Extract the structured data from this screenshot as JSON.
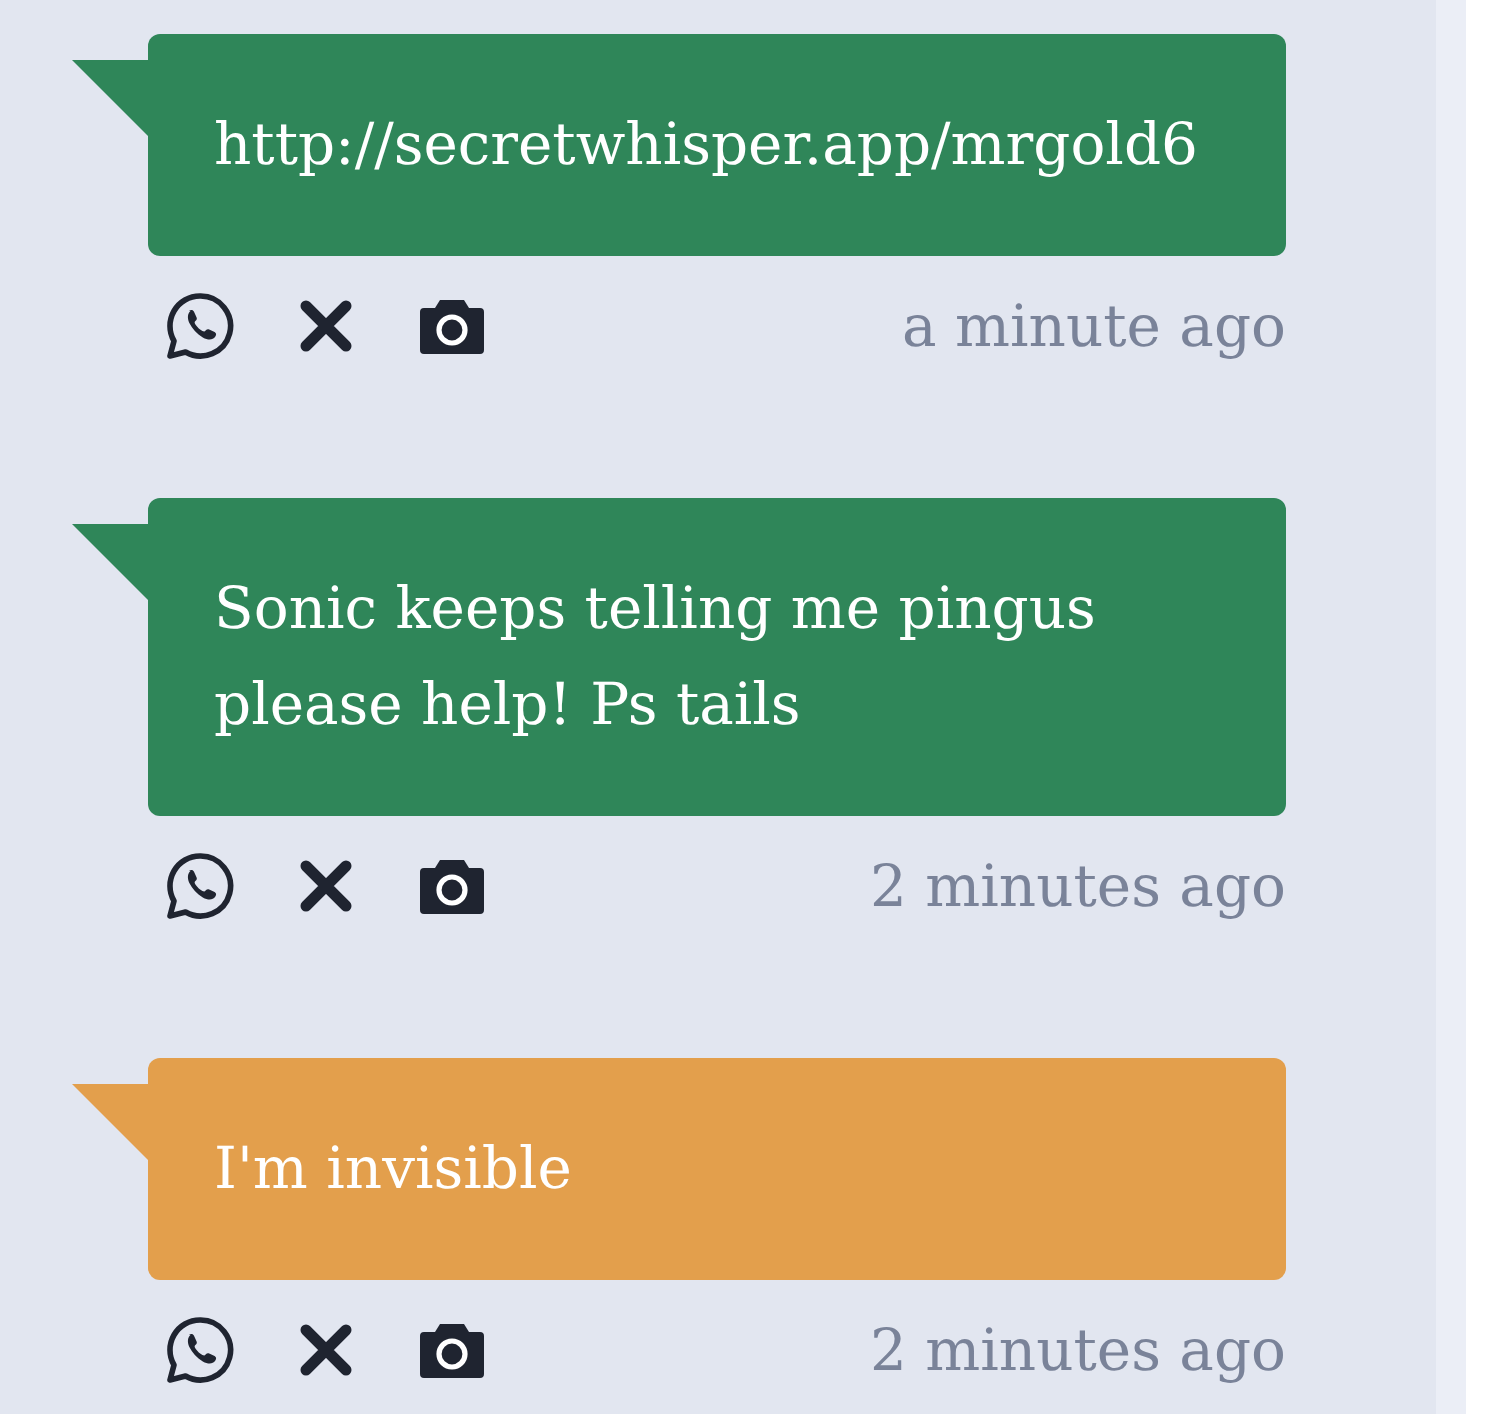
{
  "messages": [
    {
      "text": "http://secretwhisper.app/mrgold6",
      "color": "#2f8659",
      "time": "a minute ago"
    },
    {
      "text": "Sonic keeps telling me pingus please help! Ps tails",
      "color": "#2f8659",
      "time": "2 minutes ago"
    },
    {
      "text": "I'm invisible",
      "color": "#e39f4c",
      "time": "2 minutes ago"
    }
  ]
}
